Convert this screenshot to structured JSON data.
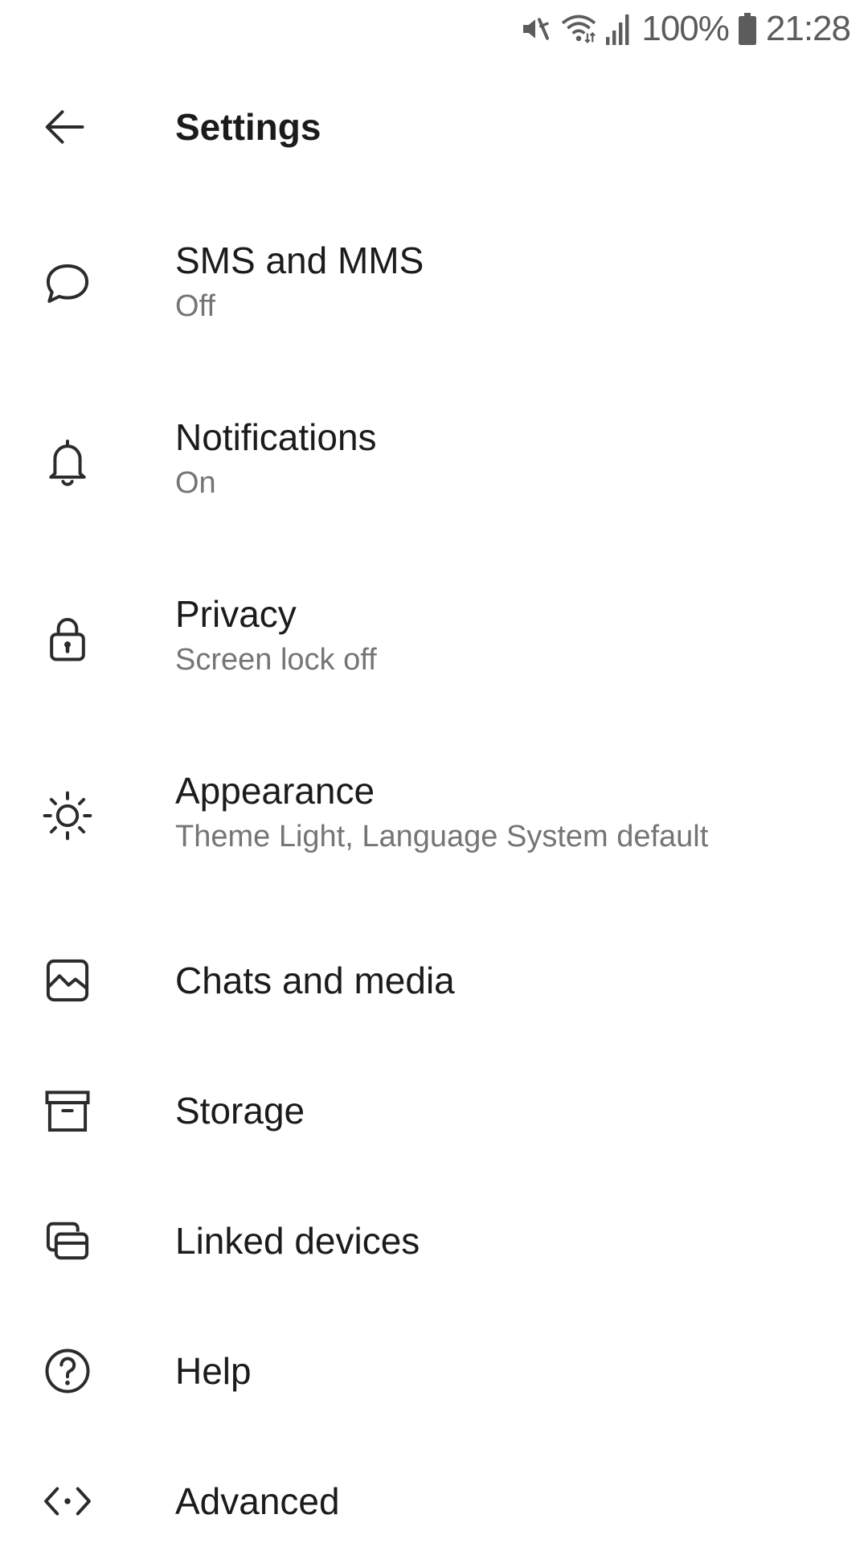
{
  "status_bar": {
    "icons": [
      "mute-icon",
      "wifi-icon",
      "signal-icon",
      "battery-icon"
    ],
    "battery_text": "100%",
    "time": "21:28"
  },
  "app_bar": {
    "back_icon": "back-arrow-icon",
    "title": "Settings"
  },
  "settings": [
    {
      "icon": "chat-bubble-icon",
      "label": "SMS and MMS",
      "summary": "Off"
    },
    {
      "icon": "bell-icon",
      "label": "Notifications",
      "summary": "On"
    },
    {
      "icon": "lock-icon",
      "label": "Privacy",
      "summary": "Screen lock off"
    },
    {
      "icon": "sun-icon",
      "label": "Appearance",
      "summary": "Theme Light, Language System default"
    },
    {
      "icon": "image-icon",
      "label": "Chats and media",
      "summary": ""
    },
    {
      "icon": "archive-box-icon",
      "label": "Storage",
      "summary": ""
    },
    {
      "icon": "linked-devices-icon",
      "label": "Linked devices",
      "summary": ""
    },
    {
      "icon": "help-icon",
      "label": "Help",
      "summary": ""
    },
    {
      "icon": "code-icon",
      "label": "Advanced",
      "summary": ""
    }
  ],
  "colors": {
    "text_primary": "#1b1b1d",
    "text_secondary": "#757575",
    "icon": "#2b2b2d",
    "status_bar": "#5c5c5c",
    "background": "#ffffff"
  }
}
